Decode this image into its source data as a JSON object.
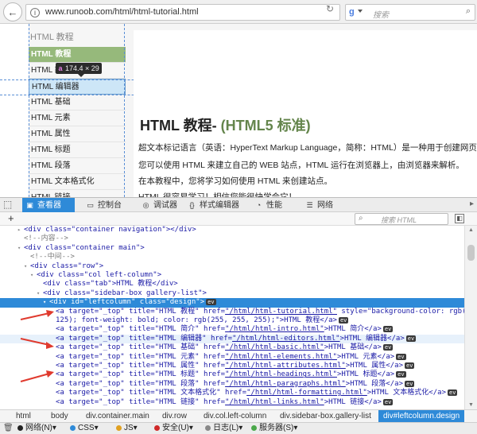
{
  "browser": {
    "url": "www.runoob.com/html/html-tutorial.html",
    "search_placeholder": "搜索"
  },
  "page": {
    "sidebar": {
      "tab_title": "HTML 教程",
      "items": [
        "HTML 教程",
        "HTML 简介",
        "HTML 编辑器",
        "HTML 基础",
        "HTML 元素",
        "HTML 属性",
        "HTML 标题",
        "HTML 段落",
        "HTML 文本格式化",
        "HTML 链接"
      ]
    },
    "tooltip": {
      "tag": "a",
      "dims": "174.4 × 29"
    },
    "title_main": "HTML 教程- ",
    "title_suffix": "(HTML5 标准)",
    "paragraphs": [
      "超文本标记语言（英语：HyperText Markup Language，简称：HTML）是一种用于创建网页的标准",
      "您可以使用 HTML 来建立自己的 WEB 站点，HTML 运行在浏览器上，由浏览器来解析。",
      "在本教程中，您将学习如何使用 HTML 来创建站点。",
      "HTML 很容易学习！相信您能很快学会它！"
    ]
  },
  "devtools": {
    "tabs": [
      "查看器",
      "控制台",
      "调试器",
      "样式编辑器",
      "性能",
      "网络"
    ],
    "filter_placeholder": "搜索 HTML",
    "code": {
      "l1": {
        "p": "<div class=",
        "v": "\"container navigation\"",
        "s": "></div>"
      },
      "l2": "<!--内容-->",
      "l3": {
        "p": "<div class=",
        "v": "\"container main\"",
        "s": ">"
      },
      "l4": "<!--中间-->",
      "l5": {
        "p": "<div class=",
        "v": "\"row\"",
        "s": ">"
      },
      "l6": {
        "p": "<div class=",
        "v": "\"col left-column\"",
        "s": ">"
      },
      "l7": {
        "p": "<div class=",
        "v": "\"tab\"",
        "s": ">HTML 教程</div>"
      },
      "l8": {
        "p": "<div class=",
        "v": "\"sidebar-box gallery-list\"",
        "s": ">"
      },
      "l9": {
        "p": "<div id=",
        "v": "\"leftcolumn\"",
        "m": " class=",
        "v2": "\"design\"",
        "s": ">"
      },
      "a1": {
        "p": "<a target=\"_top\" title=\"HTML 教程\" href=",
        "link": "\"/html/html-tutorial.html\"",
        "s": " style=\"background-color: rgb(150, 185,"
      },
      "a1b": "125); font-weight: bold; color: rgb(255, 255, 255);\">HTML 教程</a>",
      "a2": {
        "p": "<a target=\"_top\" title=\"HTML 简介\" href=",
        "link": "\"/html/html-intro.html\"",
        "s": ">HTML 简介</a>"
      },
      "a3": {
        "p": "<a target=\"_top\" title=\"HTML 编辑器\" href=",
        "link": "\"/html/html-editors.html\"",
        "s": ">HTML 编辑器</a>"
      },
      "a4": {
        "p": "<a target=\"_top\" title=\"HTML 基础\" href=",
        "link": "\"/html/html-basic.html\"",
        "s": ">HTML 基础</a>"
      },
      "a5": {
        "p": "<a target=\"_top\" title=\"HTML 元素\" href=",
        "link": "\"/html/html-elements.html\"",
        "s": ">HTML 元素</a>"
      },
      "a6": {
        "p": "<a target=\"_top\" title=\"HTML 属性\" href=",
        "link": "\"/html/html-attributes.html\"",
        "s": ">HTML 属性</a>"
      },
      "a7": {
        "p": "<a target=\"_top\" title=\"HTML 标题\" href=",
        "link": "\"/html/html-headings.html\"",
        "s": ">HTML 标题</a>"
      },
      "a8": {
        "p": "<a target=\"_top\" title=\"HTML 段落\" href=",
        "link": "\"/html/html-paragraphs.html\"",
        "s": ">HTML 段落</a>"
      },
      "a9": {
        "p": "<a target=\"_top\" title=\"HTML 文本格式化\" href=",
        "link": "\"/html/html-formatting.html\"",
        "s": ">HTML 文本格式化</a>"
      },
      "a10": {
        "p": "<a target=\"_top\" title=\"HTML 链接\" href=",
        "link": "\"/html/html-links.html\"",
        "s": ">HTML 链接</a>"
      },
      "ev": "ev"
    },
    "breadcrumbs": [
      "html",
      "body",
      "div.container.main",
      "div.row",
      "div.col.left-column",
      "div.sidebar-box.gallery-list",
      "div#leftcolumn.design"
    ]
  },
  "statusbar": {
    "items": [
      "网络(N)",
      "CSS",
      "JS",
      "安全(U)",
      "日志(L)",
      "服务器(S)"
    ]
  },
  "colors": {
    "active_item": "#96b97b",
    "selection": "#2e8ad8",
    "arrow": "#e03a2e"
  }
}
